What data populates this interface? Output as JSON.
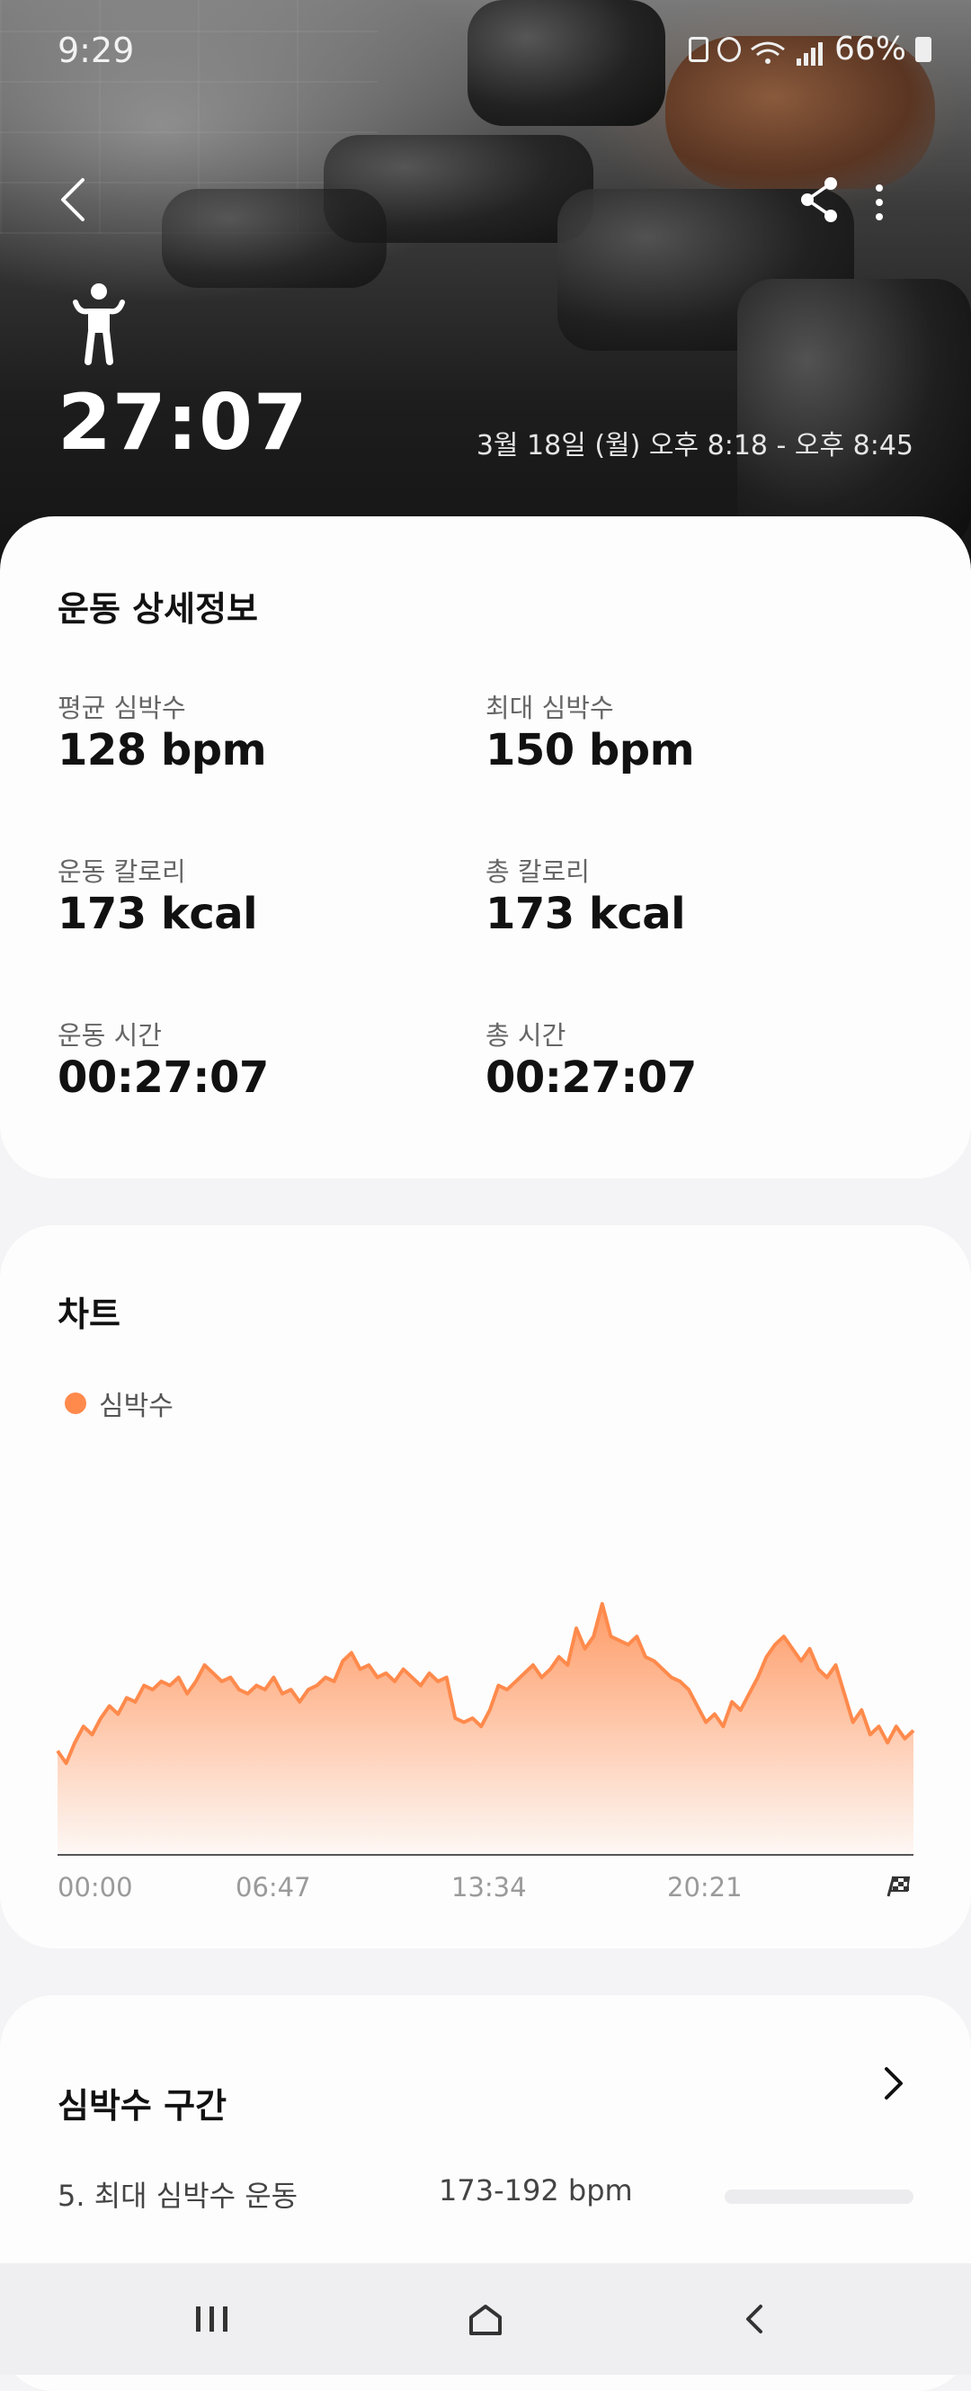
{
  "status_bar": {
    "time": "9:29",
    "battery": "66%"
  },
  "header": {
    "duration": "27:07",
    "date_range": "3월 18일 (월) 오후 8:18 - 오후 8:45",
    "icons": {
      "back": "back-arrow-icon",
      "share": "share-icon",
      "more": "more-vertical-icon",
      "workout": "strength-training-icon"
    }
  },
  "details": {
    "title": "운동 상세정보",
    "metrics": [
      {
        "label": "평균 심박수",
        "value": "128 bpm"
      },
      {
        "label": "최대 심박수",
        "value": "150 bpm"
      },
      {
        "label": "운동 칼로리",
        "value": "173 kcal"
      },
      {
        "label": "총 칼로리",
        "value": "173 kcal"
      },
      {
        "label": "운동 시간",
        "value": "00:27:07"
      },
      {
        "label": "총 시간",
        "value": "00:27:07"
      }
    ]
  },
  "chart": {
    "title": "차트",
    "legend_label": "심박수",
    "color": "#ff8a4c",
    "x_ticks": [
      "00:00",
      "06:47",
      "13:34",
      "20:21"
    ],
    "end_icon": "finish-flag-icon"
  },
  "chart_data": {
    "type": "area",
    "series": [
      {
        "name": "심박수",
        "values": [
          110,
          107,
          112,
          116,
          114,
          118,
          121,
          119,
          123,
          122,
          126,
          125,
          127,
          126,
          128,
          124,
          127,
          131,
          129,
          127,
          128,
          125,
          124,
          126,
          125,
          128,
          124,
          125,
          122,
          125,
          126,
          128,
          127,
          132,
          134,
          130,
          131,
          128,
          129,
          127,
          130,
          128,
          126,
          129,
          127,
          128,
          118,
          117,
          118,
          116,
          120,
          126,
          125,
          127,
          129,
          131,
          128,
          130,
          133,
          131,
          140,
          135,
          138,
          146,
          138,
          137,
          136,
          138,
          133,
          132,
          130,
          128,
          127,
          125,
          121,
          117,
          119,
          116,
          122,
          120,
          124,
          128,
          133,
          136,
          138,
          135,
          132,
          135,
          130,
          128,
          131,
          124,
          117,
          120,
          114,
          116,
          112,
          116,
          113,
          115
        ]
      }
    ],
    "x_range": [
      "00:00",
      "27:07"
    ],
    "y_range_bpm": [
      85,
      155
    ],
    "grid": false,
    "legend_position": "top-left"
  },
  "zones": {
    "title": "심박수 구간",
    "items": [
      {
        "name": "5. 최대 심박수 운동",
        "range": "173-192 bpm",
        "fraction": 0.0
      }
    ]
  },
  "navbar": {
    "icons": [
      "recent-apps-icon",
      "home-icon",
      "back-icon"
    ]
  }
}
